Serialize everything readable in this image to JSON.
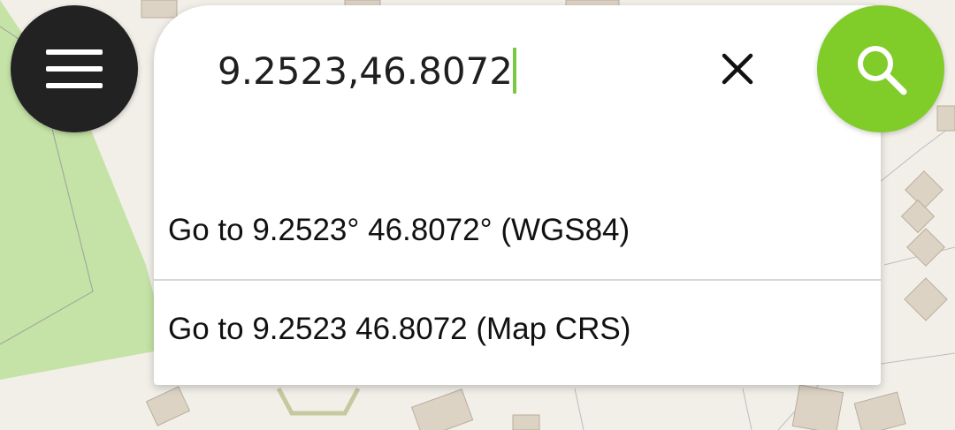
{
  "search": {
    "value": "9.2523,46.8072"
  },
  "results": [
    {
      "label": "Go to 9.2523° 46.8072° (WGS84)"
    },
    {
      "label": "Go to 9.2523 46.8072 (Map CRS)"
    }
  ],
  "icons": {
    "menu": "hamburger-menu-icon",
    "clear": "close-icon",
    "search": "search-icon"
  },
  "colors": {
    "menu_button": "#222222",
    "search_button": "#80cc28",
    "caret": "#7ac943",
    "map_land": "#f2efe9",
    "map_park": "#c5e3a6",
    "map_building": "#dcd3c5"
  }
}
